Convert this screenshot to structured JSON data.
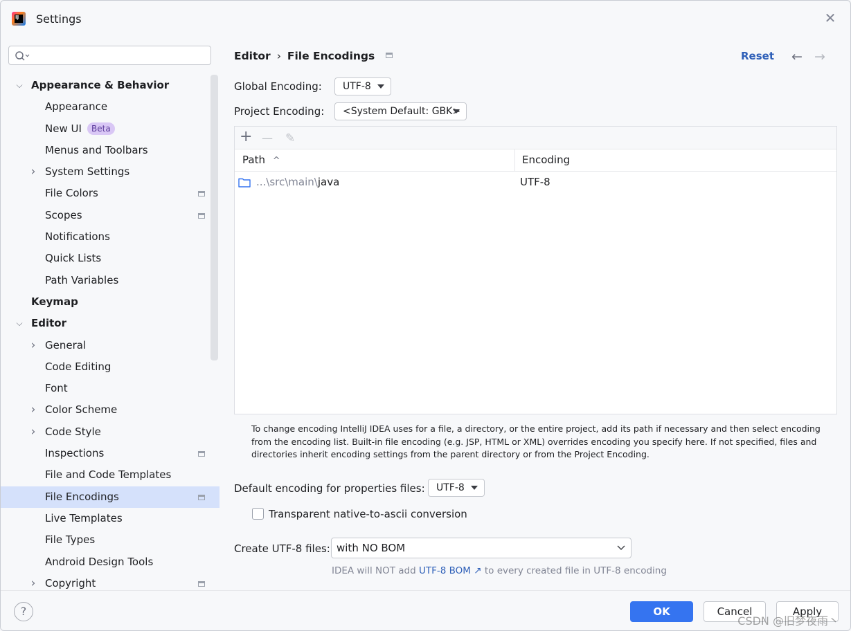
{
  "window": {
    "title": "Settings"
  },
  "search": {
    "value": ""
  },
  "tree": [
    {
      "label": "Appearance & Behavior",
      "level": 0,
      "arrow": "down",
      "bold": true
    },
    {
      "label": "Appearance",
      "level": 1
    },
    {
      "label": "New UI",
      "level": 1,
      "badge": "Beta"
    },
    {
      "label": "Menus and Toolbars",
      "level": 1
    },
    {
      "label": "System Settings",
      "level": 1,
      "arrow": "right"
    },
    {
      "label": "File Colors",
      "level": 1,
      "scoped": true
    },
    {
      "label": "Scopes",
      "level": 1,
      "scoped": true
    },
    {
      "label": "Notifications",
      "level": 1
    },
    {
      "label": "Quick Lists",
      "level": 1
    },
    {
      "label": "Path Variables",
      "level": 1
    },
    {
      "label": "Keymap",
      "level": 0,
      "bold": true
    },
    {
      "label": "Editor",
      "level": 0,
      "arrow": "down",
      "bold": true
    },
    {
      "label": "General",
      "level": 1,
      "arrow": "right"
    },
    {
      "label": "Code Editing",
      "level": 1
    },
    {
      "label": "Font",
      "level": 1
    },
    {
      "label": "Color Scheme",
      "level": 1,
      "arrow": "right"
    },
    {
      "label": "Code Style",
      "level": 1,
      "arrow": "right"
    },
    {
      "label": "Inspections",
      "level": 1,
      "scoped": true
    },
    {
      "label": "File and Code Templates",
      "level": 1
    },
    {
      "label": "File Encodings",
      "level": 1,
      "scoped": true,
      "selected": true
    },
    {
      "label": "Live Templates",
      "level": 1
    },
    {
      "label": "File Types",
      "level": 1
    },
    {
      "label": "Android Design Tools",
      "level": 1
    },
    {
      "label": "Copyright",
      "level": 1,
      "arrow": "right",
      "scoped": true
    }
  ],
  "breadcrumb": {
    "parent": "Editor",
    "separator": "›",
    "current": "File Encodings"
  },
  "header": {
    "reset": "Reset",
    "back": "←",
    "forward": "→"
  },
  "global_encoding": {
    "label": "Global Encoding:",
    "value": "UTF-8"
  },
  "project_encoding": {
    "label": "Project Encoding:",
    "value": "<System Default: GBK>"
  },
  "table": {
    "toolbar": {
      "add": "+",
      "remove": "—",
      "edit": "✎"
    },
    "columns": {
      "path": "Path",
      "sort": "^",
      "encoding": "Encoding"
    },
    "rows": [
      {
        "path_prefix": "...\\src\\main\\",
        "path_name": "java",
        "encoding": "UTF-8"
      }
    ]
  },
  "help_text": "To change encoding IntelliJ IDEA uses for a file, a directory, or the entire project, add its path if necessary and then select encoding from the encoding list. Built-in file encoding (e.g. JSP, HTML or XML) overrides encoding you specify here. If not specified, files and directories inherit encoding settings from the parent directory or from the Project Encoding.",
  "properties_encoding": {
    "label": "Default encoding for properties files:",
    "value": "UTF-8"
  },
  "transparent_ascii": {
    "label": "Transparent native-to-ascii conversion",
    "checked": false
  },
  "create_utf8": {
    "label": "Create UTF-8 files:",
    "value": "with NO BOM"
  },
  "bom_note": {
    "before": "IDEA will NOT add",
    "link": "UTF-8 BOM ↗",
    "after": "to every created file in UTF-8 encoding"
  },
  "footer": {
    "help": "?",
    "ok": "OK",
    "cancel": "Cancel",
    "apply": "Apply"
  },
  "watermark": "CSDN @旧梦夜雨丶",
  "colors": {
    "accent": "#3574f0",
    "link": "#2e5fb8",
    "selection": "#d5e1fb"
  }
}
